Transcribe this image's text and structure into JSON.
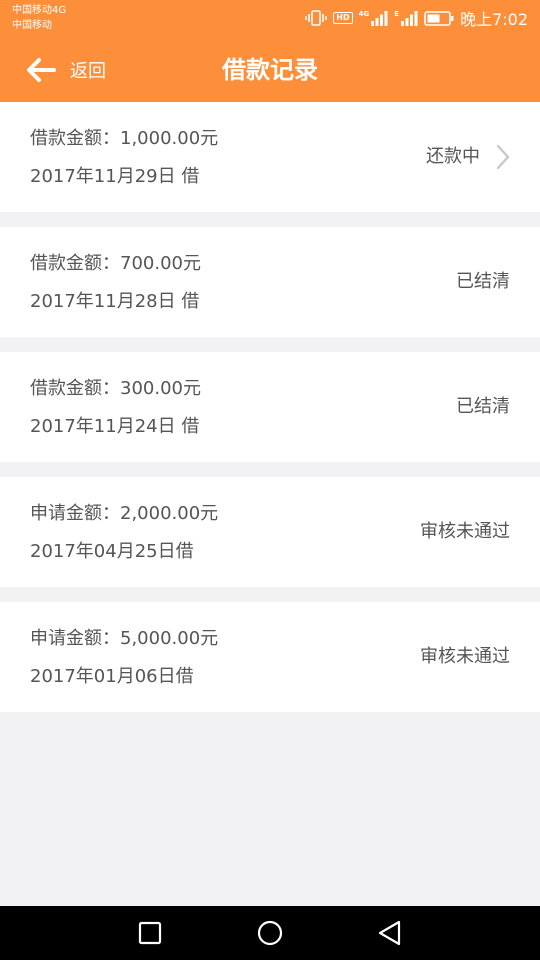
{
  "status_bar": {
    "carrier_1": "中国移动4G",
    "carrier_2": "中国移动",
    "hd_label": "HD",
    "signal_1_label": "4G",
    "signal_2_label": "E",
    "time": "晚上7:02"
  },
  "header": {
    "back_label": "返回",
    "title": "借款记录"
  },
  "records": [
    {
      "amount": "借款金额：1,000.00元",
      "date": "2017年11月29日 借",
      "status": "还款中",
      "has_chevron": true
    },
    {
      "amount": "借款金额：700.00元",
      "date": "2017年11月28日 借",
      "status": "已结清",
      "has_chevron": false
    },
    {
      "amount": "借款金额：300.00元",
      "date": "2017年11月24日 借",
      "status": "已结清",
      "has_chevron": false
    },
    {
      "amount": "申请金额：2,000.00元",
      "date": "2017年04月25日借",
      "status": "审核未通过",
      "has_chevron": false
    },
    {
      "amount": "申请金额：5,000.00元",
      "date": "2017年01月06日借",
      "status": "审核未通过",
      "has_chevron": false
    }
  ],
  "nav_bar": {
    "icons": [
      "recent-apps-icon",
      "home-icon",
      "back-triangle-icon"
    ]
  },
  "colors": {
    "accent": "#fd8f3a",
    "background": "#f2f2f5",
    "card": "#ffffff",
    "text": "#555555",
    "nav_bar": "#000000"
  }
}
